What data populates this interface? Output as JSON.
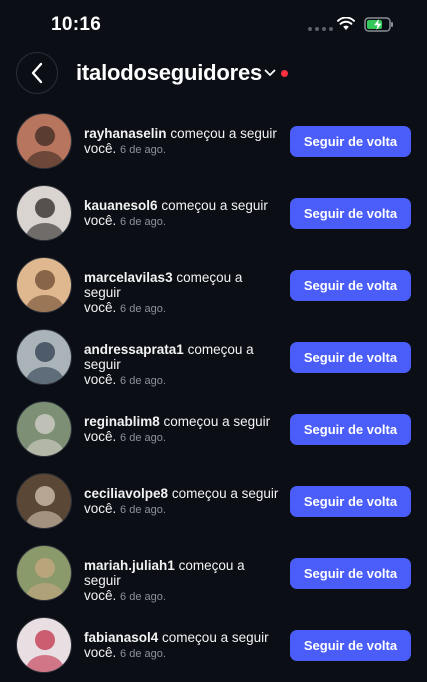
{
  "status_bar": {
    "time": "10:16"
  },
  "header": {
    "title": "italodoseguidores"
  },
  "notification_text": "começou a seguir",
  "notification_you": "você.",
  "follow_back_label": "Seguir de volta",
  "rows": [
    {
      "username": "rayhanaselin",
      "date": "6 de ago.",
      "avatar_colors": [
        "#b8755e",
        "#3b2a22"
      ]
    },
    {
      "username": "kauanesol6",
      "date": "6 de ago.",
      "avatar_colors": [
        "#d9d4cf",
        "#2a2624"
      ]
    },
    {
      "username": "marcelavilas3",
      "date": "6 de ago.",
      "avatar_colors": [
        "#e0b890",
        "#6b4a30"
      ]
    },
    {
      "username": "andressaprata1",
      "date": "6 de ago.",
      "avatar_colors": [
        "#a9b3b8",
        "#2f3d52"
      ]
    },
    {
      "username": "reginablim8",
      "date": "6 de ago.",
      "avatar_colors": [
        "#7d8f74",
        "#d6d2cc"
      ]
    },
    {
      "username": "ceciliavolpe8",
      "date": "6 de ago.",
      "avatar_colors": [
        "#5a4736",
        "#d6c4b2"
      ]
    },
    {
      "username": "mariah.juliah1",
      "date": "6 de ago.",
      "avatar_colors": [
        "#8a9a6a",
        "#c8a882"
      ]
    },
    {
      "username": "fabianasol4",
      "date": "6 de ago.",
      "avatar_colors": [
        "#e9dfe3",
        "#c2304a"
      ]
    }
  ],
  "colors": {
    "background": "#0b0e14",
    "accent": "#4a5df9",
    "unread_dot": "#ff3040"
  }
}
